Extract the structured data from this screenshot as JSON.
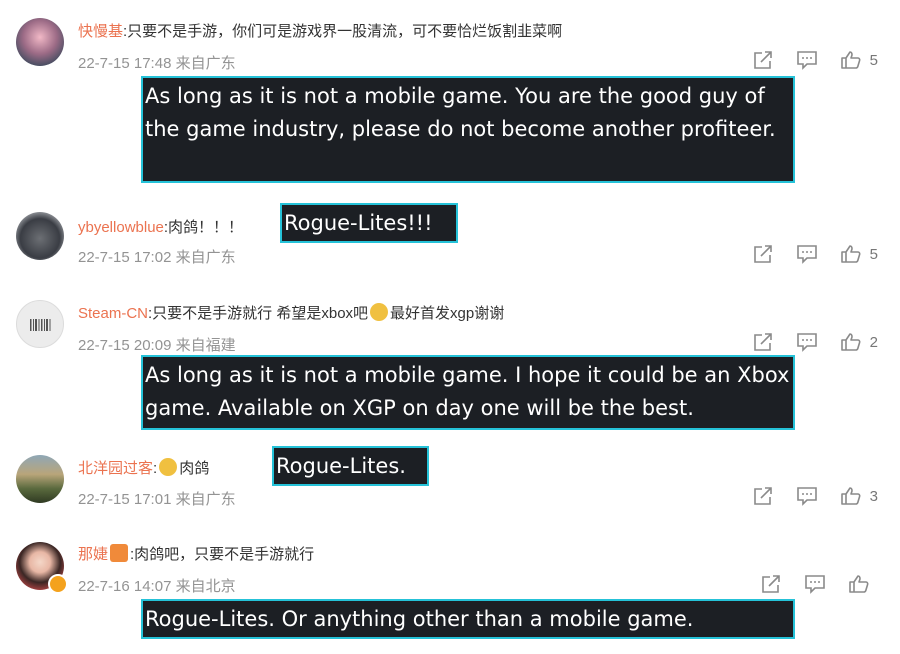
{
  "comments": [
    {
      "user": "快慢基",
      "text": ":只要不是手游，你们可是游戏界一股清流，可不要恰烂饭割韭菜啊",
      "meta": "22-7-15 17:48 来自广东",
      "likes": "5",
      "translation": "As long as it is not a mobile game. You are the good guy of the game industry, please do not become another profiteer."
    },
    {
      "user": "ybyellowblue",
      "text": ":肉鸽！！！",
      "meta": "22-7-15 17:02 来自广东",
      "likes": "5",
      "translation": "Rogue-Lites!!!"
    },
    {
      "user": "Steam-CN",
      "text": ":只要不是手游就行  希望是xbox吧",
      "text2": "最好首发xgp谢谢",
      "meta": "22-7-15 20:09 来自福建",
      "likes": "2",
      "translation": "As long as it is not a mobile game. I hope it could be an Xbox game. Available on XGP on day one will be the best."
    },
    {
      "user": "北洋园过客",
      "text": ":",
      "text2": "肉鸽",
      "meta": "22-7-15 17:01 来自广东",
      "likes": "3",
      "translation": "Rogue-Lites."
    },
    {
      "user": "那婕",
      "text": ":肉鸽吧，只要不是手游就行",
      "meta": "22-7-16 14:07 来自北京",
      "likes": "",
      "translation": "Rogue-Lites. Or anything other than a mobile game."
    }
  ],
  "icons": [
    "share-icon",
    "comment-icon",
    "like-icon"
  ],
  "colors": {
    "username": "#eb7350",
    "translation_bg": "#1c1f24",
    "translation_border": "#25c2d8"
  }
}
